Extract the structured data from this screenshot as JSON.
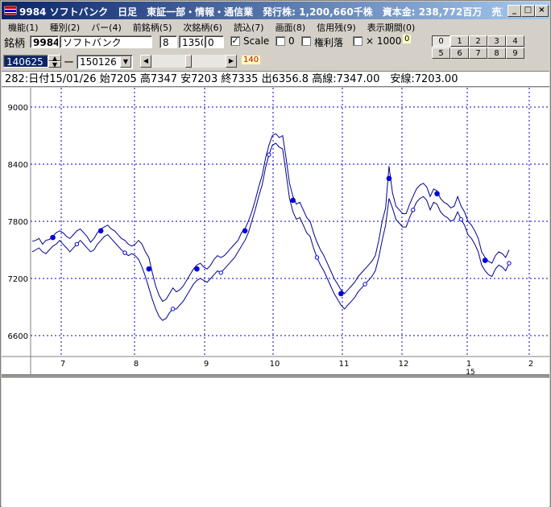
{
  "window": {
    "title": "9984 ソフトバンク　日足　東証一部・情報・通信業　発行株: 1,200,660千株　資本金: 238,772百万　売買単…",
    "minimize": "_",
    "maximize": "□",
    "close": "×"
  },
  "menu": [
    "機能(1)",
    "種別(2)",
    "バー(4)",
    "前銘柄(5)",
    "次銘柄(6)",
    "読込(7)",
    "画面(8)",
    "信用残(9)",
    "表示期間(0)"
  ],
  "toolbar": {
    "code_label": "銘柄",
    "code": "9984",
    "name": "ソフトバンク",
    "field_a": "8",
    "field_b": "1350",
    "field_c": "0",
    "scale_label": "Scale",
    "scale_checked": true,
    "zero_label": "0",
    "rights_label": "権利落",
    "x1000_label": "× 1000",
    "zero_badge": "0",
    "date_start": "140625",
    "dash": "ー",
    "date_end": "150126",
    "period_count": "140",
    "num_buttons": [
      "0",
      "1",
      "2",
      "3",
      "4",
      "5",
      "6",
      "7",
      "8",
      "9"
    ],
    "selected_num": "0"
  },
  "info": {
    "text": "282:日付15/01/26 始7205 高7347 安7203 終7335 出6356.8 高線:7347.00　安線:7203.00"
  },
  "chart_data": {
    "type": "line",
    "ylim": [
      6350,
      9300
    ],
    "y_ticks": [
      6600,
      7200,
      7800,
      8400,
      9000
    ],
    "x_month_labels": [
      "7",
      "8",
      "9",
      "10",
      "11",
      "12",
      "1",
      "1",
      "2"
    ],
    "x_year_label": "15",
    "n_days": 140,
    "series": [
      {
        "role": "high",
        "values": [
          7590,
          7600,
          7620,
          7560,
          7600,
          7610,
          7640,
          7680,
          7700,
          7680,
          7640,
          7620,
          7660,
          7700,
          7720,
          7680,
          7640,
          7580,
          7620,
          7680,
          7720,
          7740,
          7760,
          7720,
          7700,
          7660,
          7620,
          7600,
          7560,
          7540,
          7560,
          7600,
          7560,
          7480,
          7420,
          7260,
          7120,
          7020,
          6960,
          6980,
          7040,
          7100,
          7060,
          7080,
          7120,
          7180,
          7240,
          7300,
          7340,
          7360,
          7320,
          7300,
          7340,
          7400,
          7440,
          7420,
          7440,
          7480,
          7520,
          7560,
          7600,
          7680,
          7720,
          7800,
          7900,
          8020,
          8160,
          8280,
          8460,
          8600,
          8700,
          8720,
          8680,
          8700,
          8460,
          8200,
          8060,
          7980,
          8000,
          7920,
          7840,
          7800,
          7680,
          7580,
          7500,
          7440,
          7360,
          7280,
          7200,
          7140,
          7080,
          7040,
          7080,
          7120,
          7160,
          7220,
          7260,
          7300,
          7340,
          7380,
          7440,
          7600,
          7800,
          7940,
          8380,
          8100,
          7960,
          7920,
          7880,
          7880,
          7980,
          8060,
          8140,
          8180,
          8200,
          8160,
          8060,
          8140,
          8120,
          8040,
          8000,
          7980,
          7940,
          7960,
          8060,
          7960,
          7900,
          7800,
          7760,
          7700,
          7620,
          7480,
          7420,
          7380,
          7360,
          7440,
          7480,
          7460,
          7420,
          7500
        ],
        "color": "#00008b"
      },
      {
        "role": "low",
        "values": [
          7480,
          7500,
          7520,
          7480,
          7460,
          7500,
          7540,
          7560,
          7600,
          7560,
          7520,
          7480,
          7520,
          7560,
          7600,
          7560,
          7520,
          7480,
          7500,
          7560,
          7600,
          7640,
          7660,
          7620,
          7580,
          7540,
          7500,
          7470,
          7440,
          7460,
          7440,
          7400,
          7320,
          7220,
          7100,
          6980,
          6880,
          6800,
          6760,
          6780,
          6840,
          6880,
          6880,
          6920,
          6960,
          7020,
          7080,
          7140,
          7180,
          7200,
          7180,
          7160,
          7200,
          7240,
          7280,
          7260,
          7300,
          7340,
          7380,
          7420,
          7480,
          7540,
          7600,
          7680,
          7800,
          7920,
          8060,
          8180,
          8360,
          8500,
          8600,
          8620,
          8580,
          8560,
          8300,
          8040,
          7900,
          7820,
          7840,
          7760,
          7680,
          7640,
          7520,
          7420,
          7340,
          7280,
          7200,
          7120,
          7040,
          6980,
          6920,
          6880,
          6920,
          6960,
          7000,
          7060,
          7100,
          7140,
          7180,
          7220,
          7280,
          7420,
          7600,
          7760,
          8040,
          7940,
          7820,
          7780,
          7740,
          7740,
          7840,
          7920,
          8000,
          8040,
          8060,
          8020,
          7920,
          8000,
          7980,
          7900,
          7860,
          7840,
          7800,
          7820,
          7900,
          7820,
          7760,
          7660,
          7620,
          7560,
          7480,
          7340,
          7280,
          7240,
          7220,
          7300,
          7340,
          7320,
          7280,
          7360
        ],
        "color": "#00008b"
      }
    ]
  }
}
